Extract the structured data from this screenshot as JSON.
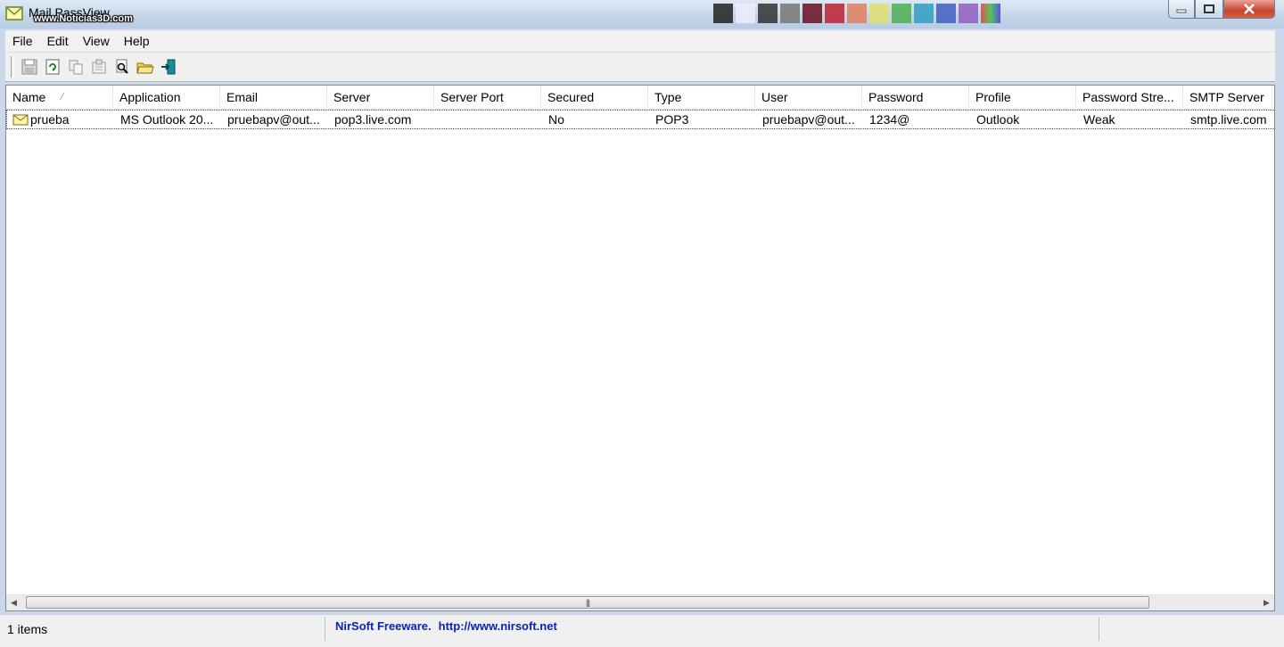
{
  "window": {
    "title": "Mail PassView",
    "watermark": "www.Noticias3D.com"
  },
  "menu": [
    "File",
    "Edit",
    "View",
    "Help"
  ],
  "toolbar": [
    "save-icon",
    "refresh-icon",
    "copy-icon",
    "properties-icon",
    "find-icon",
    "open-folder-icon",
    "exit-icon"
  ],
  "columns": [
    "Name",
    "Application",
    "Email",
    "Server",
    "Server Port",
    "Secured",
    "Type",
    "User",
    "Password",
    "Profile",
    "Password Stre...",
    "SMTP Server"
  ],
  "rows": [
    {
      "name": "prueba",
      "application": "MS Outlook 20...",
      "email": "pruebapv@out...",
      "server": "pop3.live.com",
      "server_port": "",
      "secured": "No",
      "type": "POP3",
      "user": "pruebapv@out...",
      "password": "1234@",
      "profile": "Outlook",
      "password_strength": "Weak",
      "smtp_server": "smtp.live.com"
    }
  ],
  "status": {
    "items_count": "1 items",
    "freeware": "NirSoft Freeware.",
    "url": "http://www.nirsoft.net"
  }
}
